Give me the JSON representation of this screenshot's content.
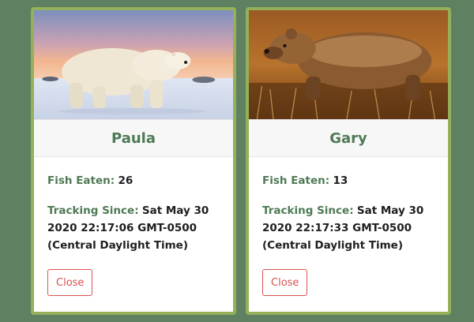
{
  "cards": [
    {
      "name": "Paula",
      "fish_label": "Fish Eaten:",
      "fish_value": "26",
      "tracking_label": "Tracking Since:",
      "tracking_value": "Sat May 30 2020 22:17:06 GMT-0500 (Central Daylight Time)",
      "close_label": "Close",
      "photo": "polar-bear"
    },
    {
      "name": "Gary",
      "fish_label": "Fish Eaten:",
      "fish_value": "13",
      "tracking_label": "Tracking Since:",
      "tracking_value": "Sat May 30 2020 22:17:33 GMT-0500 (Central Daylight Time)",
      "close_label": "Close",
      "photo": "grizzly-bear"
    }
  ],
  "colors": {
    "page_background": "#5f8061",
    "card_border": "#94b05a",
    "accent_green": "#4e7a55",
    "close_red": "#d9534f"
  }
}
